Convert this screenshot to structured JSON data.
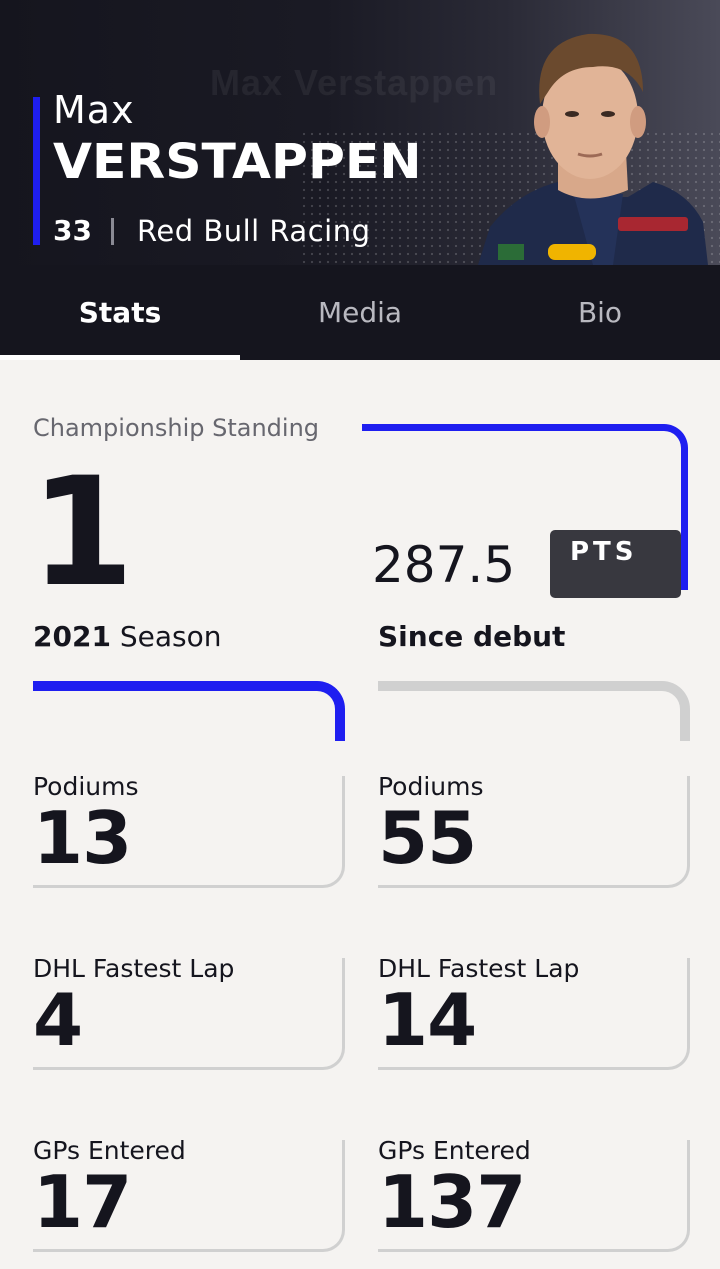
{
  "driver": {
    "first_name": "Max",
    "last_name": "VERSTAPPEN",
    "ghost_name": "Max Verstappen",
    "number": "33",
    "team": "Red Bull Racing"
  },
  "tabs": [
    {
      "label": "Stats",
      "active": true
    },
    {
      "label": "Media",
      "active": false
    },
    {
      "label": "Bio",
      "active": false
    }
  ],
  "standing": {
    "label": "Championship Standing",
    "position": "1",
    "points": "287.5",
    "points_unit": "PTS"
  },
  "season": {
    "title_bold": "2021",
    "title_rest": " Season",
    "stats": [
      {
        "label": "Podiums",
        "value": "13"
      },
      {
        "label": "DHL Fastest Lap",
        "value": "4"
      },
      {
        "label": "GPs Entered",
        "value": "17"
      }
    ]
  },
  "career": {
    "title": "Since debut",
    "stats": [
      {
        "label": "Podiums",
        "value": "55"
      },
      {
        "label": "DHL Fastest Lap",
        "value": "14"
      },
      {
        "label": "GPs Entered",
        "value": "137"
      }
    ]
  },
  "colors": {
    "accent": "#1e1ef0",
    "dark": "#15151e",
    "background": "#f5f3f1"
  }
}
